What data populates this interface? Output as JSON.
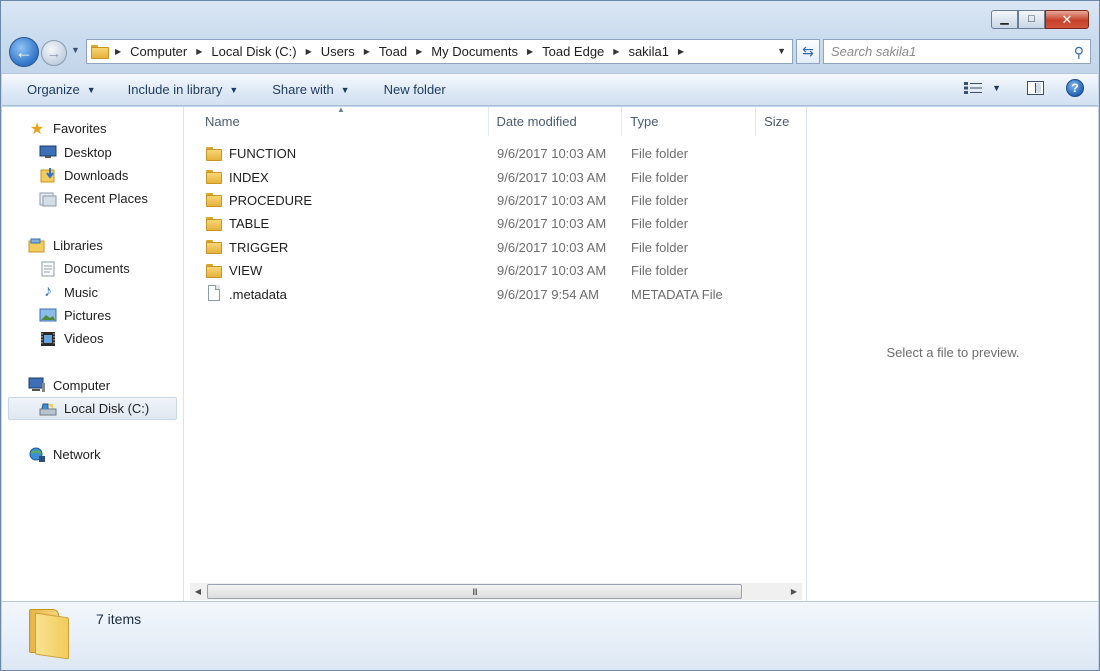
{
  "window": {
    "caption": {
      "minimize": "▁",
      "maximize": "□",
      "close": "✕"
    }
  },
  "nav": {
    "back_glyph": "←",
    "forward_glyph": "→",
    "recent_glyph": "▼",
    "breadcrumbs": [
      "Computer",
      "Local Disk (C:)",
      "Users",
      "Toad",
      "My Documents",
      "Toad Edge",
      "sakila1"
    ],
    "separator": "▶",
    "dropdown_glyph": "▼",
    "refresh_glyph": "⇆",
    "search_placeholder": "Search sakila1",
    "search_glyph": "⚲"
  },
  "toolbar": {
    "organize": "Organize",
    "include_in_library": "Include in library",
    "share_with": "Share with",
    "new_folder": "New folder",
    "caret": "▼",
    "help": "?"
  },
  "sidebar": {
    "favorites": {
      "label": "Favorites",
      "items": [
        "Desktop",
        "Downloads",
        "Recent Places"
      ]
    },
    "libraries": {
      "label": "Libraries",
      "items": [
        "Documents",
        "Music",
        "Pictures",
        "Videos"
      ]
    },
    "computer": {
      "label": "Computer",
      "items": [
        "Local Disk (C:)"
      ]
    },
    "network": {
      "label": "Network"
    },
    "selected": "Local Disk (C:)"
  },
  "filelist": {
    "columns": {
      "name": "Name",
      "date": "Date modified",
      "type": "Type",
      "size": "Size"
    },
    "sort_glyph": "▲",
    "rows": [
      {
        "name": "FUNCTION",
        "date": "9/6/2017 10:03 AM",
        "type": "File folder",
        "kind": "folder"
      },
      {
        "name": "INDEX",
        "date": "9/6/2017 10:03 AM",
        "type": "File folder",
        "kind": "folder"
      },
      {
        "name": "PROCEDURE",
        "date": "9/6/2017 10:03 AM",
        "type": "File folder",
        "kind": "folder"
      },
      {
        "name": "TABLE",
        "date": "9/6/2017 10:03 AM",
        "type": "File folder",
        "kind": "folder"
      },
      {
        "name": "TRIGGER",
        "date": "9/6/2017 10:03 AM",
        "type": "File folder",
        "kind": "folder"
      },
      {
        "name": "VIEW",
        "date": "9/6/2017 10:03 AM",
        "type": "File folder",
        "kind": "folder"
      },
      {
        "name": ".metadata",
        "date": "9/6/2017 9:54 AM",
        "type": "METADATA File",
        "kind": "file"
      }
    ],
    "scroll": {
      "left_glyph": "◀",
      "right_glyph": "▶",
      "grip": "III"
    }
  },
  "preview": {
    "message": "Select a file to preview."
  },
  "details": {
    "item_count": "7 items"
  },
  "colors": {
    "accent": "#2f73c8",
    "toolbar_text": "#1e3a5f",
    "folder": "#f2cc5c"
  }
}
